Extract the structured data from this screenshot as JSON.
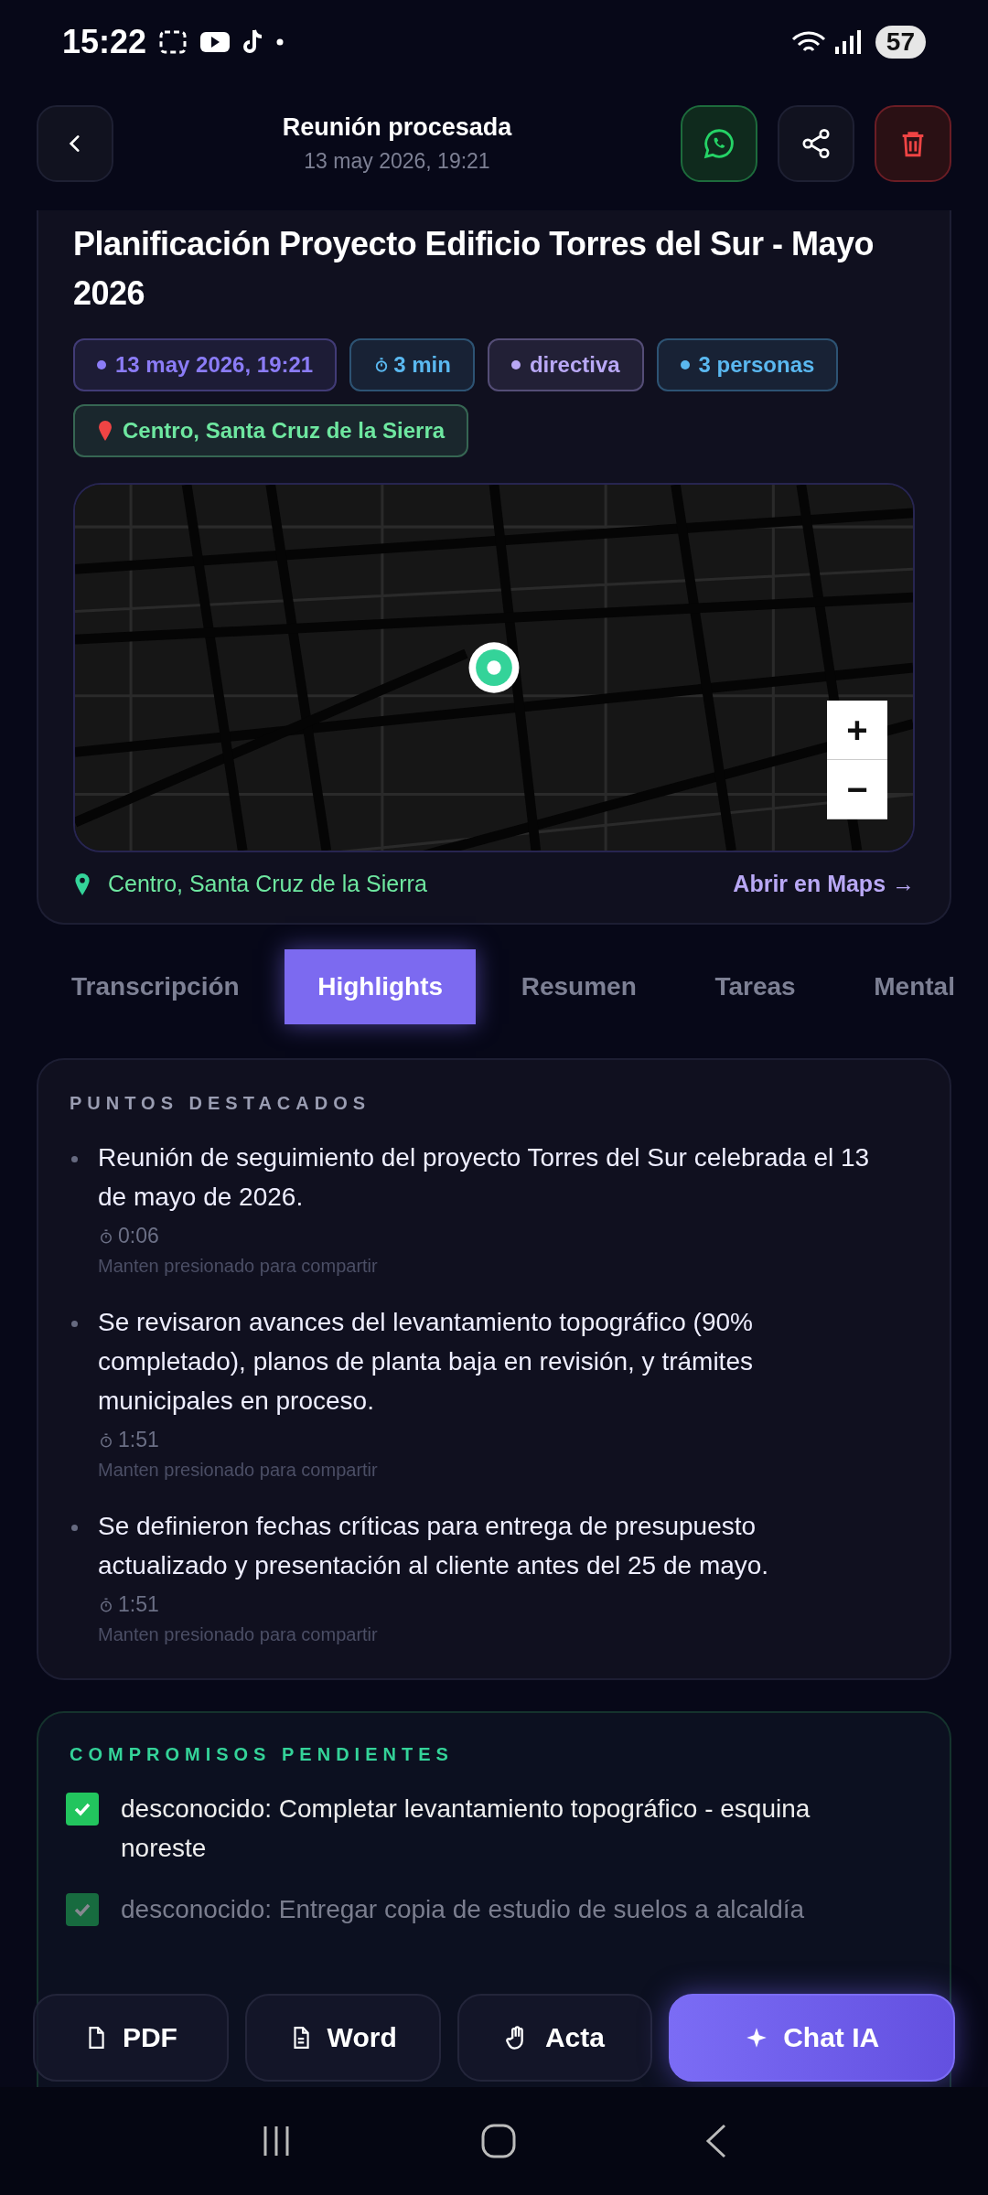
{
  "status_bar": {
    "time": "15:22",
    "battery": "57"
  },
  "header": {
    "title": "Reunión procesada",
    "subtitle": "13 may 2026, 19:21"
  },
  "meeting": {
    "title": "Planificación Proyecto Edificio Torres del Sur - Mayo 2026",
    "chips": [
      {
        "kind": "dot",
        "label": "13 may 2026, 19:21",
        "color": "#8b7cf6"
      },
      {
        "kind": "timer",
        "label": "3 min",
        "color": "#5ab8f0"
      },
      {
        "kind": "dot",
        "label": "directiva",
        "color": "#b9a8f5"
      },
      {
        "kind": "dot",
        "label": "3 personas",
        "color": "#5ab8f0"
      },
      {
        "kind": "pin",
        "label": "Centro, Santa Cruz de la Sierra",
        "color": "#6ee7a0"
      }
    ],
    "map": {
      "zoom_in": "+",
      "zoom_out": "−"
    },
    "location": "Centro, Santa Cruz de la Sierra",
    "maps_link": "Abrir en Maps →"
  },
  "tabs": [
    {
      "label": "Transcripción",
      "selected": false
    },
    {
      "label": "Highlights",
      "selected": true
    },
    {
      "label": "Resumen",
      "selected": false
    },
    {
      "label": "Tareas",
      "selected": false
    },
    {
      "label": "Mental",
      "selected": false
    }
  ],
  "highlights": {
    "heading": "PUNTOS DESTACADOS",
    "items": [
      {
        "text": "Reunión de seguimiento del proyecto Torres del Sur celebrada el 13 de mayo de 2026.",
        "time": "0:06",
        "hint": "Manten presionado para compartir"
      },
      {
        "text": "Se revisaron avances del levantamiento topográfico (90% completado), planos de planta baja en revisión, y trámites municipales en proceso.",
        "time": "1:51",
        "hint": "Manten presionado para compartir"
      },
      {
        "text": "Se definieron fechas críticas para entrega de presupuesto actualizado y presentación al cliente antes del 25 de mayo.",
        "time": "1:51",
        "hint": "Manten presionado para compartir"
      }
    ]
  },
  "commitments": {
    "heading": "COMPROMISOS PENDIENTES",
    "items": [
      {
        "text": "desconocido: Completar levantamiento topográfico - esquina noreste",
        "checked": true,
        "dimmed": false
      },
      {
        "text": "desconocido: Entregar copia de estudio de suelos a alcaldía",
        "checked": true,
        "dimmed": true
      }
    ]
  },
  "actions": [
    {
      "kind": "file",
      "label": "PDF",
      "primary": false
    },
    {
      "kind": "doc",
      "label": "Word",
      "primary": false
    },
    {
      "kind": "hand",
      "label": "Acta",
      "primary": false
    },
    {
      "kind": "sparkle",
      "label": "Chat IA",
      "primary": true
    }
  ]
}
